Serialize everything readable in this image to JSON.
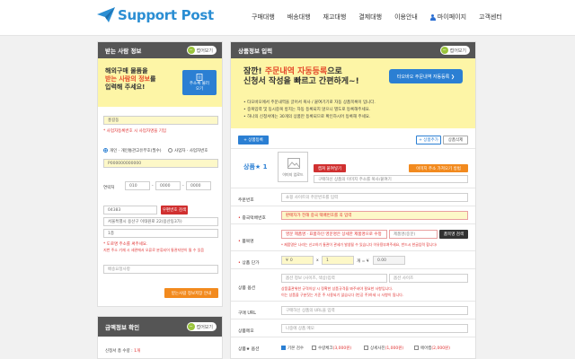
{
  "header": {
    "logo_text": "Support Post",
    "nav": [
      "구매대행",
      "배송대행",
      "재고대행",
      "결제대행",
      "이용안내",
      "마이페이지",
      "고객센터"
    ]
  },
  "recipient": {
    "title": "받는 사람 정보",
    "collapse": "접어보기",
    "banner_line1": "해외구매 물품을",
    "banner_line2_pre": "받는 사람의 정보",
    "banner_line2_post": "를",
    "banner_line3": "입력해 주세요!",
    "address_btn": "주소록 불러오기",
    "name_value": "홍길동",
    "name_note": "* 사업자등록번호 시 사업자명을 기입",
    "type_personal": "개인 · 개인통관고유부호(필수)",
    "type_business": "사업자 · 사업자번호",
    "customs_value": "P000000000000",
    "phone_label": "연락처",
    "phone1": "010",
    "phone2": "0000",
    "phone3": "0000",
    "zip_value": "04383",
    "zip_btn": "우편번호 검색",
    "addr1_value": "서울특별시 용산구 이태원로 22(용산동3가)",
    "addr2_value": "1층",
    "addr_note1": "* 도로명 주소를 써주세요.",
    "addr_note2": "지번 주소 기재 시 세관에서 오류로 분류되어 통관지연이 될 수 있음",
    "request_placeholder": "배송요청사항",
    "save_btn": "받는사람 정보저장 안내"
  },
  "amount": {
    "title": "금액정보 확인",
    "collapse": "접어보기",
    "qty_label": "신청서 총 수량 :",
    "qty_value": "1개"
  },
  "product": {
    "title": "상품정보 입력",
    "collapse": "접어보기",
    "banner_line1_pre": "잠깐! ",
    "banner_line1_hl": "주문내역 자동등록",
    "banner_line1_post": "으로",
    "banner_line2": "신청서 작성을 빠르고 간편하게~!",
    "banner_btn": "타오바오 주문내역 자동등록 ❯",
    "notes": [
      "• 타오바오에서 주문내역을 긁어서 복사 / 붙여기기로 자동 상품목록이 입니다.",
      "• 중복입력 및 동시중복 방지는 자동 등록되지 않으니 별도로 등록해주세요.",
      "• 하나의 신청서에는 30개의 상품만 등록되므로 확인하시어 등록해 주세요."
    ],
    "add_btn": "+ 상품등록",
    "tag_btn": "+ 상품추가",
    "delete_btn": "상품삭제",
    "item_label": "상품★ 1",
    "image_caption": "이미지 업로드",
    "paste_btn": "캡쳐 붙여넣기",
    "url_btn": "이미지 주소 가져오기 방법",
    "image_url_placeholder": "구매하신 상품의 이미지 주소를 복사/붙여기",
    "order_label": "주문번호",
    "order_placeholder": "쇼핑 사이트의 주문번호를 입력",
    "tracking_label": "중국택배번호",
    "tracking_placeholder": "판매자가 전해 중국 택배번호를 꼭 입력",
    "name_label": "품목명",
    "name_placeholder": "영문 제품명 · 표품하인 영문명은 상세한 제품명으로 수정",
    "name_placeholder2": "제품명(중문)",
    "category_btn": "품목명 검색",
    "name_note": "* 제품명은 나라는 신고하기 통관이 관세가 발생될 수 있습니다 이유용부쳐주세요, 반드시 한글입력 합니다!",
    "price_label": "상품 단가",
    "price_currency": "¥",
    "price_value": "0",
    "qty_value": "1",
    "total_value": "0.00",
    "option_label": "상품 옵션",
    "option_placeholder1": "옵션 정보 (사이즈, 색상)입력",
    "option_placeholder2": "옵션 사이즈",
    "option_note1": "상품출관위한 규격이상 시 정확한 상품규격을 봐주셔야 필요한 사항입니다.",
    "option_note2": "이는 상품을 구분짓는 기준 주 사용되기 않습니다 (빈공 주)하세 시 사항이 됩니다.",
    "buy_url_label": "구매 URL",
    "buy_url_placeholder": "구매하신 상품의 URL을 입력",
    "memo_label": "상품메모",
    "memo_placeholder": "나중에 상품 메모",
    "service_label": "상품★ 옵션",
    "services": [
      {
        "label": "기본 검수",
        "price": "",
        "checked": true
      },
      {
        "label": "수량체크",
        "price": "(3,000원)",
        "checked": false
      },
      {
        "label": "상세사진",
        "price": "(1,000원)",
        "checked": false
      },
      {
        "label": "에어캡",
        "price": "(2,000원)",
        "checked": false
      }
    ]
  }
}
